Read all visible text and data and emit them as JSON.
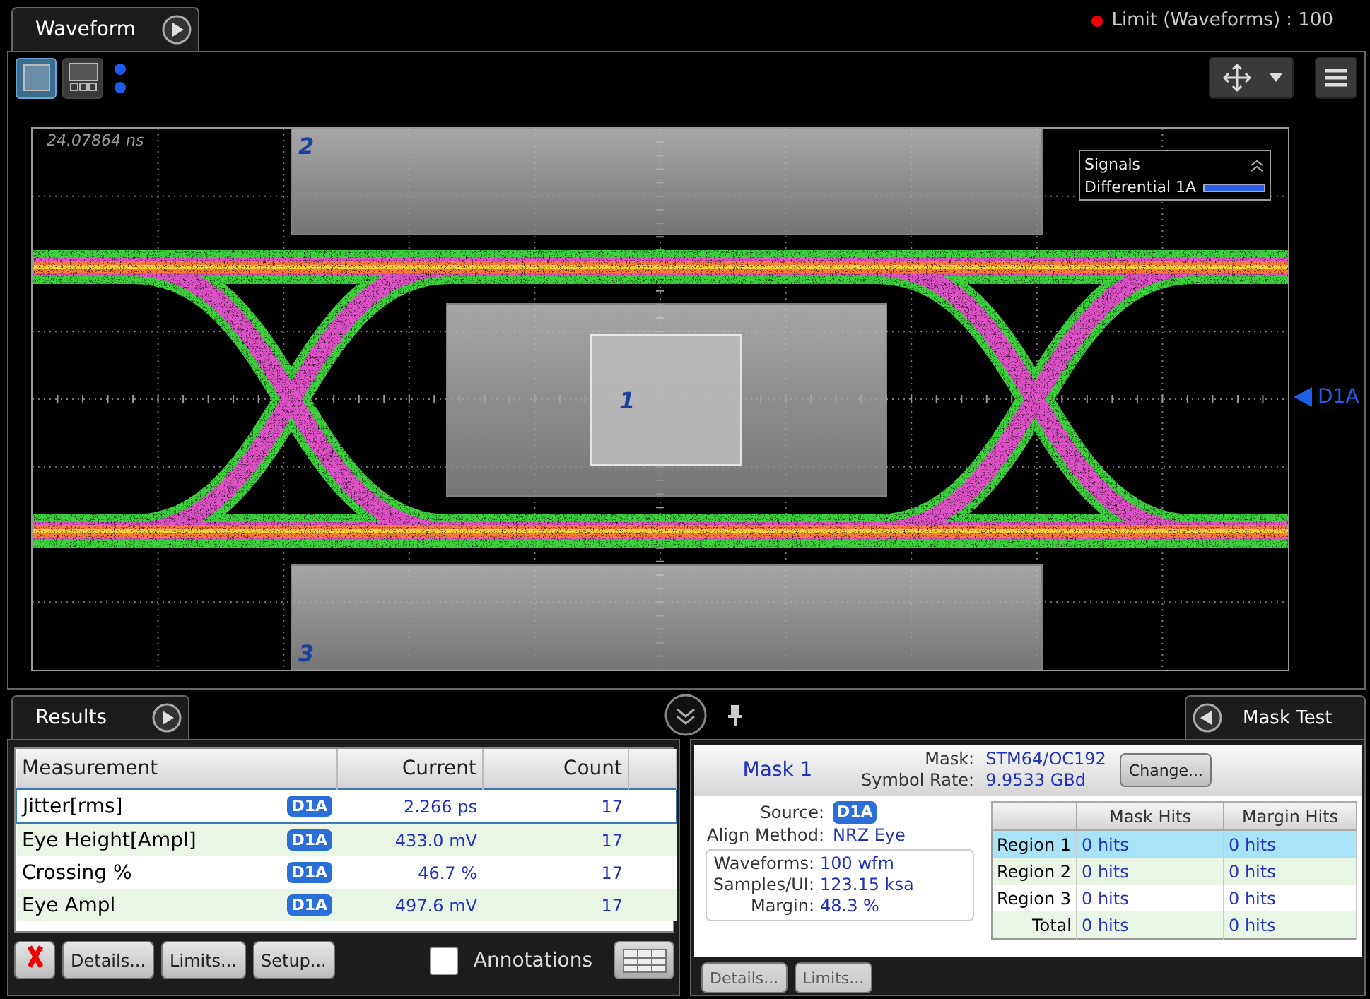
{
  "waveform_panel": {
    "tab": "Waveform",
    "limit": "Limit (Waveforms) : 100",
    "view_buttons": [
      {
        "selected": true
      },
      {
        "selected": false
      }
    ],
    "timestamp": "24.07864 ns",
    "mask_regions": [
      {
        "label": "2"
      },
      {
        "label": "1"
      },
      {
        "label": "3"
      }
    ],
    "legend": {
      "title": "Signals",
      "signal": "Differential 1A"
    },
    "channel_marker": "D1A"
  },
  "results_panel": {
    "tab": "Results",
    "columns": [
      "Measurement",
      "Current",
      "Count"
    ],
    "rows": [
      {
        "measurement": "Jitter[rms]",
        "source": "D1A",
        "current": "2.266 ps",
        "count": "17",
        "selected": true
      },
      {
        "measurement": "Eye Height[Ampl]",
        "source": "D1A",
        "current": "433.0 mV",
        "count": "17",
        "selected": false
      },
      {
        "measurement": "Crossing %",
        "source": "D1A",
        "current": "46.7 %",
        "count": "17",
        "selected": false
      },
      {
        "measurement": "Eye Ampl",
        "source": "D1A",
        "current": "497.6 mV",
        "count": "17",
        "selected": false
      }
    ],
    "buttons": [
      "Details...",
      "Limits...",
      "Setup..."
    ],
    "annotations": {
      "label": "Annotations",
      "checked": false
    }
  },
  "mask_panel": {
    "tab": "Mask Test",
    "title": "Mask 1",
    "header_fields": [
      {
        "label": "Mask:",
        "value": "STM64/OC192"
      },
      {
        "label": "Symbol Rate:",
        "value": "9.9533 GBd"
      }
    ],
    "change_button": "Change...",
    "info_fields": [
      {
        "label": "Source:",
        "value": "D1A",
        "kind": "badge"
      },
      {
        "label": "Align Method:",
        "value": "NRZ Eye",
        "kind": "text"
      }
    ],
    "stats": [
      {
        "label": "Waveforms:",
        "value": "100 wfm"
      },
      {
        "label": "Samples/UI:",
        "value": "123.15 ksa"
      },
      {
        "label": "Margin:",
        "value": "48.3 %"
      }
    ],
    "columns": [
      "Mask Hits",
      "Margin Hits"
    ],
    "rows": [
      {
        "label": "Region 1",
        "mask_hits": "0 hits",
        "margin_hits": "0 hits",
        "kind": "region",
        "selected": true
      },
      {
        "label": "Region 2",
        "mask_hits": "0 hits",
        "margin_hits": "0 hits",
        "kind": "region",
        "selected": false
      },
      {
        "label": "Region 3",
        "mask_hits": "0 hits",
        "margin_hits": "0 hits",
        "kind": "region",
        "selected": false
      },
      {
        "label": "Total",
        "mask_hits": "0 hits",
        "margin_hits": "0 hits",
        "kind": "total",
        "selected": false
      }
    ],
    "buttons": [
      {
        "label": "Details...",
        "disabled": true
      },
      {
        "label": "Limits...",
        "disabled": true
      }
    ]
  }
}
